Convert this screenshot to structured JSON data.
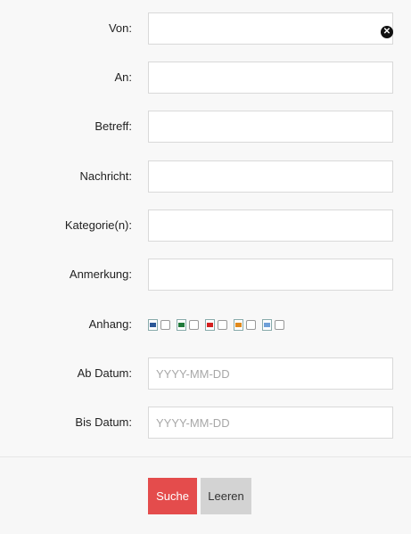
{
  "form": {
    "from": {
      "label": "Von:",
      "value": ""
    },
    "to": {
      "label": "An:",
      "value": ""
    },
    "subject": {
      "label": "Betreff:",
      "value": ""
    },
    "message": {
      "label": "Nachricht:",
      "value": ""
    },
    "categories": {
      "label": "Kategorie(n):",
      "value": ""
    },
    "remark": {
      "label": "Anmerkung:",
      "value": ""
    },
    "attachment": {
      "label": "Anhang:",
      "types": [
        {
          "icon": "word-document-icon",
          "color": "#2b5797",
          "checked": false
        },
        {
          "icon": "excel-spreadsheet-icon",
          "color": "#1f7a3a",
          "checked": false
        },
        {
          "icon": "pdf-document-icon",
          "color": "#d42020",
          "checked": false
        },
        {
          "icon": "image-file-icon",
          "color": "#e08a1e",
          "checked": false
        },
        {
          "icon": "generic-document-icon",
          "color": "#6fa0d8",
          "checked": false
        }
      ]
    },
    "date_from": {
      "label": "Ab Datum:",
      "placeholder": "YYYY-MM-DD"
    },
    "date_to": {
      "label": "Bis Datum:",
      "placeholder": "YYYY-MM-DD"
    }
  },
  "actions": {
    "search_label": "Suche",
    "clear_label": "Leeren",
    "search_color": "#e44c4c",
    "clear_color": "#d3d3d3"
  }
}
